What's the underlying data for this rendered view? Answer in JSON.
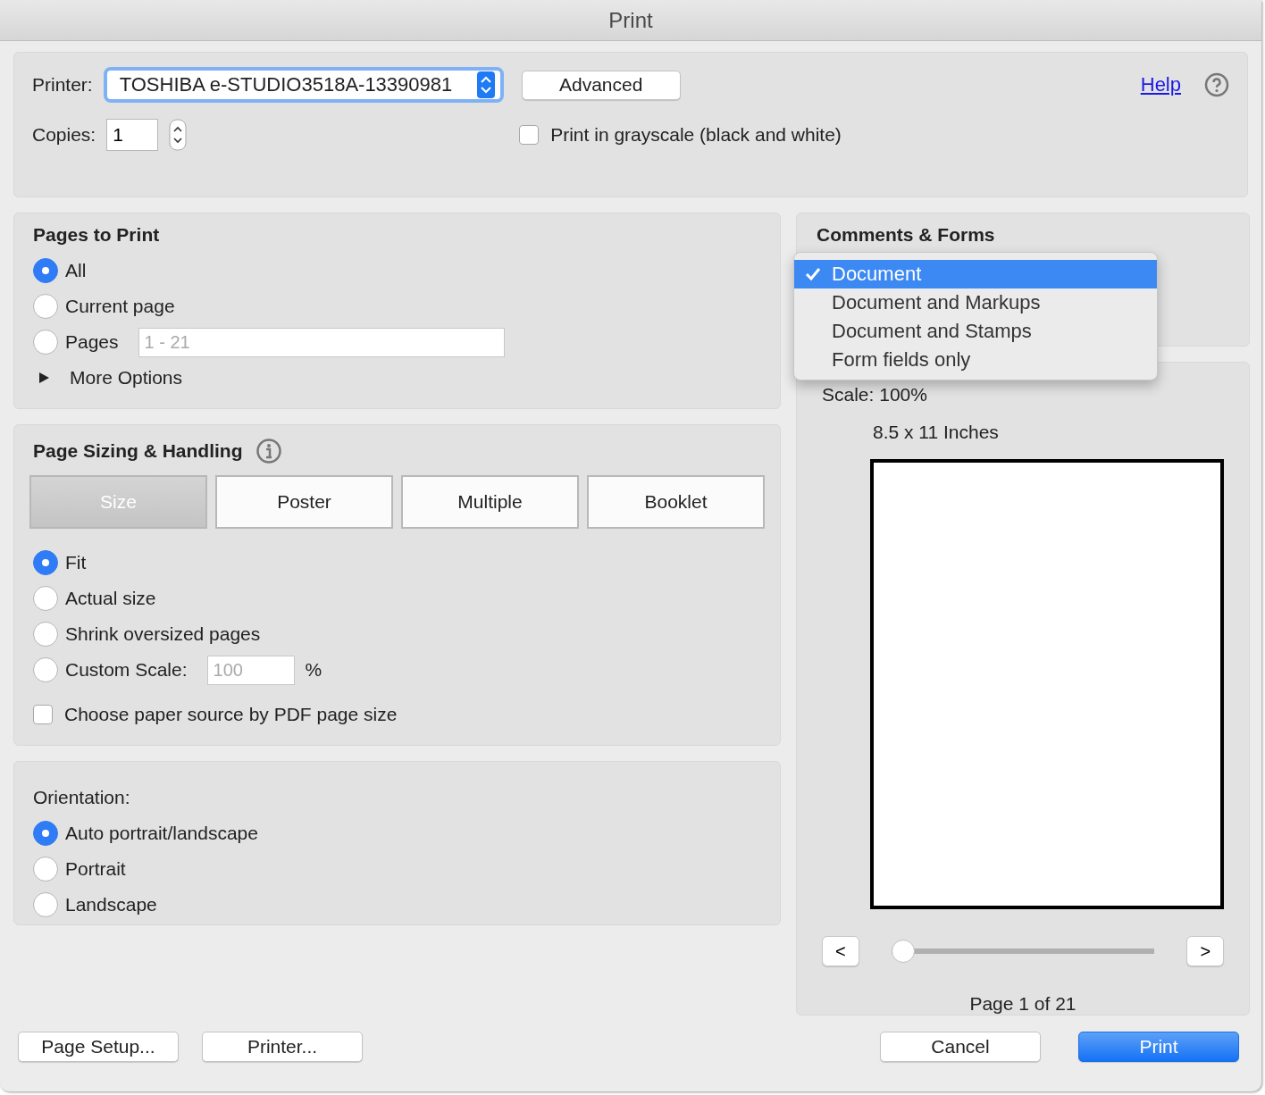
{
  "window": {
    "title": "Print"
  },
  "printer": {
    "label": "Printer:",
    "value": "TOSHIBA e-STUDIO3518A-13390981",
    "advanced": "Advanced",
    "help": "Help"
  },
  "copies": {
    "label": "Copies:",
    "value": "1"
  },
  "grayscale": {
    "label": "Print in grayscale (black and white)",
    "checked": false
  },
  "pages_to_print": {
    "title": "Pages to Print",
    "options": [
      {
        "label": "All",
        "selected": true
      },
      {
        "label": "Current page",
        "selected": false
      },
      {
        "label": "Pages",
        "selected": false,
        "placeholder": "1 - 21"
      }
    ],
    "more_options": {
      "label": "More Options",
      "expanded": false
    }
  },
  "page_sizing": {
    "title": "Page Sizing & Handling",
    "tabs": [
      {
        "label": "Size",
        "selected": true
      },
      {
        "label": "Poster",
        "selected": false
      },
      {
        "label": "Multiple",
        "selected": false
      },
      {
        "label": "Booklet",
        "selected": false
      }
    ],
    "options": [
      {
        "label": "Fit",
        "selected": true
      },
      {
        "label": "Actual size",
        "selected": false
      },
      {
        "label": "Shrink oversized pages",
        "selected": false
      },
      {
        "label": "Custom Scale:",
        "selected": false,
        "placeholder": "100",
        "unit": "%"
      }
    ],
    "paper_source": {
      "label": "Choose paper source by PDF page size",
      "checked": false
    }
  },
  "orientation": {
    "title": "Orientation:",
    "options": [
      {
        "label": "Auto portrait/landscape",
        "selected": true
      },
      {
        "label": "Portrait",
        "selected": false
      },
      {
        "label": "Landscape",
        "selected": false
      }
    ]
  },
  "comments_forms": {
    "title": "Comments & Forms",
    "menu": [
      {
        "label": "Document",
        "selected": true
      },
      {
        "label": "Document and Markups",
        "selected": false
      },
      {
        "label": "Document and Stamps",
        "selected": false
      },
      {
        "label": "Form fields only",
        "selected": false
      }
    ]
  },
  "preview": {
    "scale": "Scale: 100%",
    "paper": "8.5 x 11 Inches",
    "prev": "<",
    "next": ">",
    "slider": {
      "level": 0
    },
    "page": "Page 1 of 21"
  },
  "buttons": {
    "page_setup": "Page Setup...",
    "printer": "Printer...",
    "cancel": "Cancel",
    "print": "Print"
  }
}
